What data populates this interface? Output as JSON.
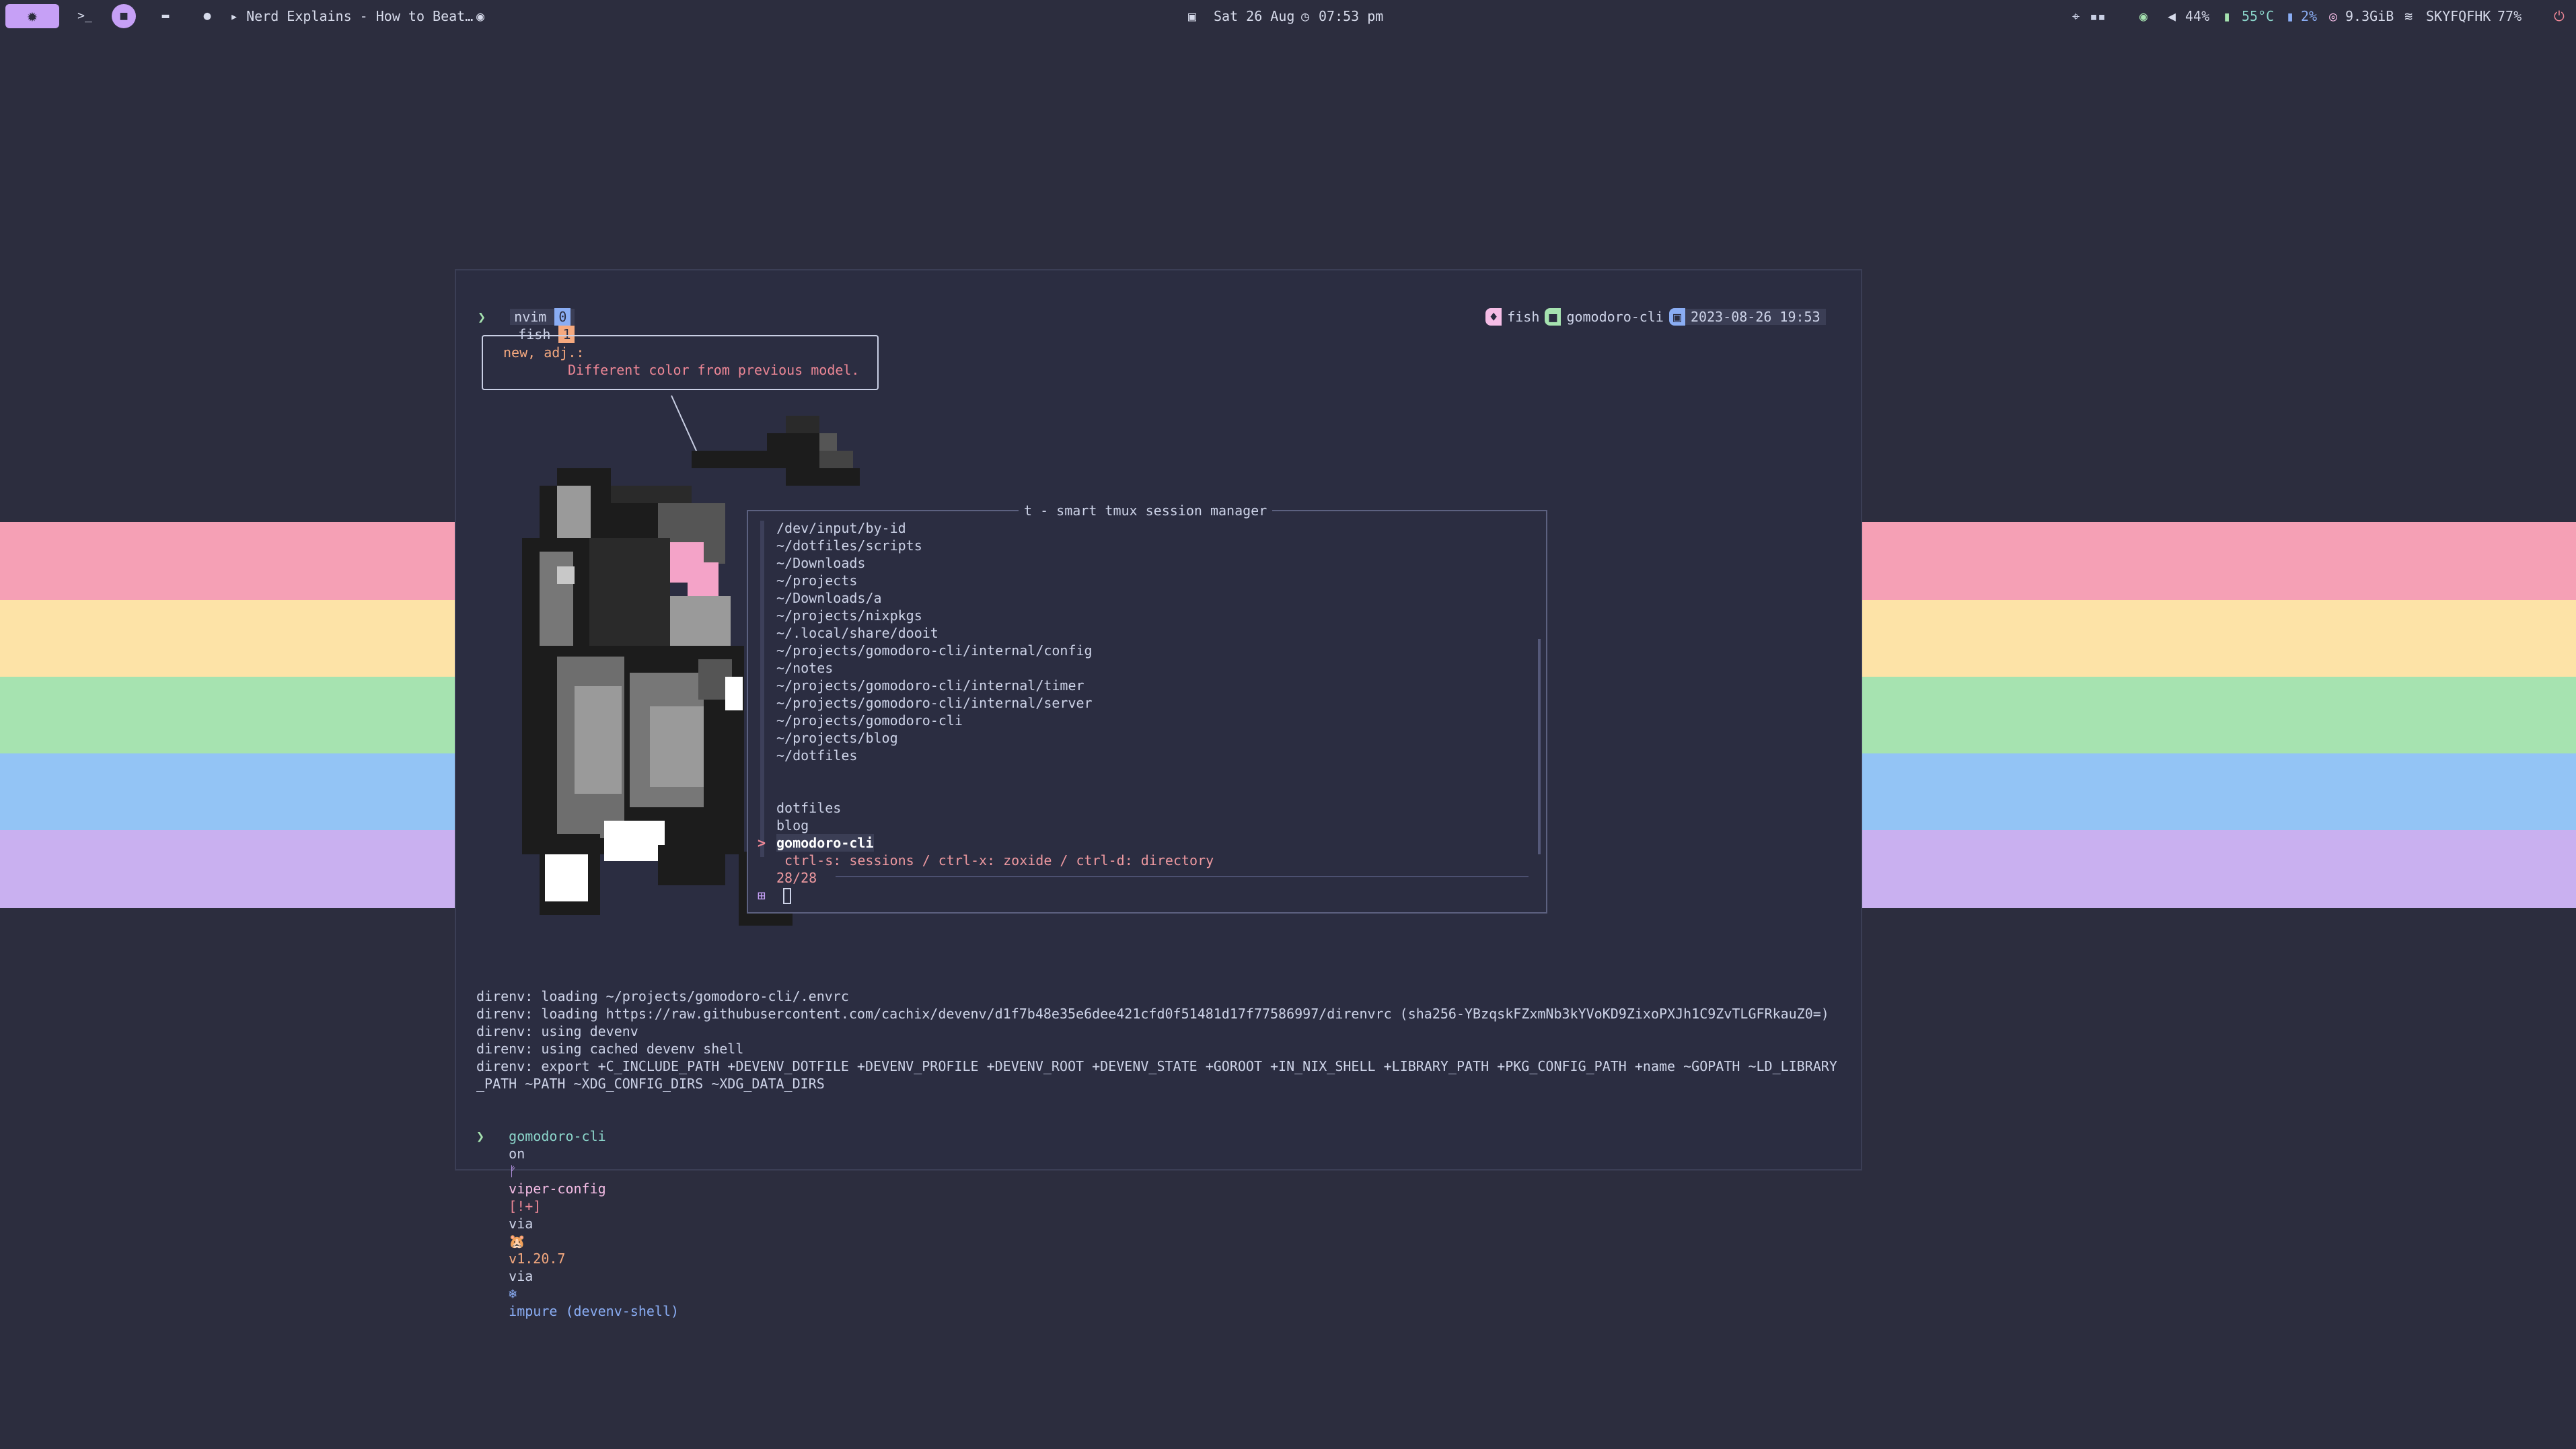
{
  "topbar": {
    "launcher_icon": "gear-icon",
    "terminal_ws_label": ">_",
    "ws2_label": "2",
    "ws3_icon": "controller-icon",
    "chat_icon": "chat-icon",
    "media_title": "▸ Nerd Explains - How to Beat…",
    "date": "Sat 26 Aug",
    "time": "07:53 pm",
    "volume_eye": "44%",
    "volume": "",
    "temp": "55°C",
    "cpu": "2%",
    "mem": "9.3GiB",
    "wifi": "SKYFQFHK",
    "battery": "77%"
  },
  "colors": {
    "stripe_pink": "#f5a0b5",
    "stripe_yellow": "#fde3a7",
    "stripe_green": "#a6e3b0",
    "stripe_blue": "#93c4f5",
    "stripe_purple": "#c9b0f0",
    "accent": "#c6a0f6"
  },
  "tmux": {
    "win1_name": "nvim",
    "win1_index": "0",
    "win2_name": "fish",
    "win2_index": "1",
    "status_shell": "fish",
    "status_session": "gomodoro-cli",
    "status_datetime": "2023-08-26 19:53"
  },
  "prompt_char": "❯",
  "fortune": {
    "line1": "new, adj.:",
    "line2": "Different color from previous model."
  },
  "session_manager": {
    "title": "t - smart tmux session manager",
    "directories": [
      "/dev/input/by-id",
      "~/dotfiles/scripts",
      "~/Downloads",
      "~/projects",
      "~/Downloads/a",
      "~/projects/nixpkgs",
      "~/.local/share/dooit",
      "~/projects/gomodoro-cli/internal/config",
      "~/notes",
      "~/projects/gomodoro-cli/internal/timer",
      "~/projects/gomodoro-cli/internal/server",
      "~/projects/gomodoro-cli",
      "~/projects/blog",
      "~/dotfiles"
    ],
    "sessions": [
      "dotfiles",
      "blog"
    ],
    "selected_session": "gomodoro-cli",
    "selected_marker": ">",
    "help": "ctrl-s: sessions / ctrl-x: zoxide / ctrl-d: directory",
    "count": "28/28",
    "query_icon": "⊞"
  },
  "direnv_output": [
    "direnv: loading ~/projects/gomodoro-cli/.envrc",
    "direnv: loading https://raw.githubusercontent.com/cachix/devenv/d1f7b48e35e6dee421cfd0f51481d17f77586997/direnvrc (sha256-YBzqskFZxmNb3kYVoKD9ZixoPXJh1C9ZvTLGFRkauZ0=)",
    "direnv: using devenv",
    "direnv: using cached devenv shell",
    "direnv: export +C_INCLUDE_PATH +DEVENV_DOTFILE +DEVENV_PROFILE +DEVENV_ROOT +DEVENV_STATE +GOROOT +IN_NIX_SHELL +LIBRARY_PATH +PKG_CONFIG_PATH +name ~GOPATH ~LD_LIBRARY",
    "_PATH ~PATH ~XDG_CONFIG_DIRS ~XDG_DATA_DIRS"
  ],
  "starship": {
    "dir": "gomodoro-cli",
    "on": "on",
    "branch_icon": "ᚠ",
    "branch": "viper-config",
    "status": "[!+]",
    "via1": "via",
    "go_icon": "🐹",
    "go_version": "v1.20.7",
    "via2": "via",
    "nix_icon": "❄",
    "nix_env": "impure (devenv-shell)"
  }
}
